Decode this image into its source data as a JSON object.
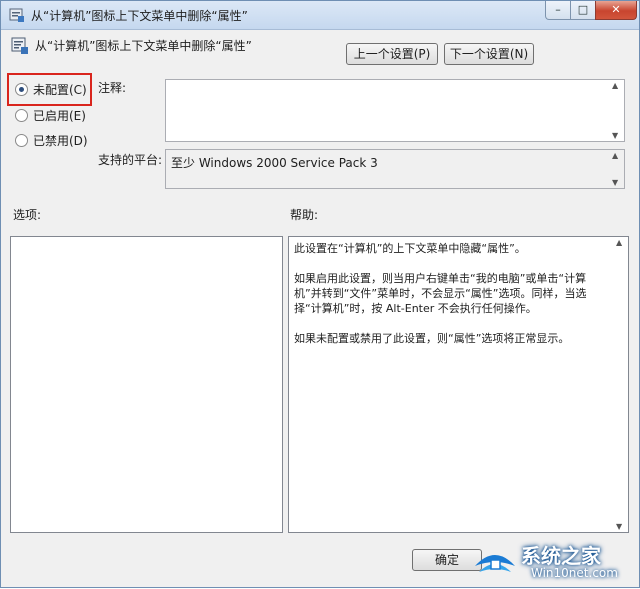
{
  "window": {
    "title": "从“计算机”图标上下文菜单中删除“属性”",
    "controls": {
      "minimize": "–",
      "maximize": "□",
      "close": "✕"
    }
  },
  "header": {
    "title": "从“计算机”图标上下文菜单中删除“属性”",
    "prev_button": "上一个设置(P)",
    "next_button": "下一个设置(N)"
  },
  "state": {
    "options": [
      {
        "label": "未配置(C)",
        "checked": true
      },
      {
        "label": "已启用(E)",
        "checked": false
      },
      {
        "label": "已禁用(D)",
        "checked": false
      }
    ]
  },
  "comment": {
    "label": "注释:",
    "value": ""
  },
  "platform": {
    "label": "支持的平台:",
    "value": "至少 Windows 2000 Service Pack 3"
  },
  "options_panel": {
    "label": "选项:"
  },
  "help_panel": {
    "label": "帮助:",
    "paragraphs": [
      "此设置在“计算机”的上下文菜单中隐藏“属性”。",
      "如果启用此设置，则当用户右键单击“我的电脑”或单击“计算机”并转到“文件”菜单时，不会显示“属性”选项。同样，当选择“计算机”时，按 Alt-Enter 不会执行任何操作。",
      "如果未配置或禁用了此设置，则“属性”选项将正常显示。"
    ]
  },
  "footer": {
    "ok_button": "确定"
  },
  "watermark": {
    "title": "系统之家",
    "url": "Win10net.com"
  },
  "colors": {
    "highlight_border": "#d9251d",
    "titlebar": "#c5d8ef",
    "watermark_blue": "#1a7bd4"
  },
  "icons": {
    "app": "policy-icon",
    "watermark": "win10net-logo"
  }
}
